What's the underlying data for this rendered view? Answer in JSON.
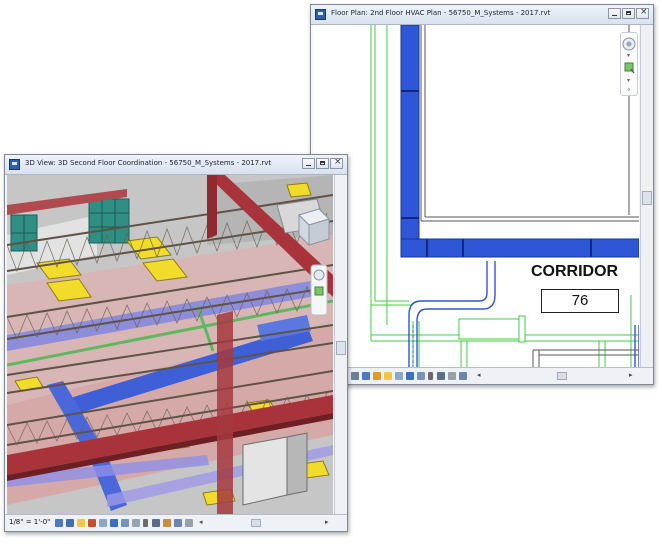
{
  "floor_plan_window": {
    "title": "Floor Plan: 2nd Floor HVAC Plan - 56750_M_Systems - 2017.rvt",
    "room": {
      "name": "CORRIDOR",
      "number": "76"
    },
    "status_icons": [
      "scale-icon",
      "detail-level-icon",
      "visual-style-icon",
      "sun-path-icon",
      "shadows-icon",
      "crop-icon",
      "crop-visibility-icon",
      "temporary-hide-icon",
      "reveal-hidden-icon",
      "worksharing-icon",
      "analytical-model-icon",
      "highlight-icon"
    ]
  },
  "view3d_window": {
    "title": "3D View: 3D Second Floor Coordination - 56750_M_Systems - 2017.rvt",
    "scale": "1/8\" = 1'-0\"",
    "status_icons": [
      "detail-level-icon",
      "visual-style-icon",
      "sun-path-icon",
      "shadows-icon",
      "render-icon",
      "crop-icon",
      "crop-visibility-icon",
      "lock-3d-icon",
      "temporary-hide-icon",
      "reveal-hidden-icon",
      "worksharing-icon",
      "analytical-model-icon",
      "highlight-icon"
    ]
  },
  "colors": {
    "duct_blue": "#2f56d6",
    "wall_green": "#3fcf3f",
    "steel_red": "#a8333a"
  }
}
